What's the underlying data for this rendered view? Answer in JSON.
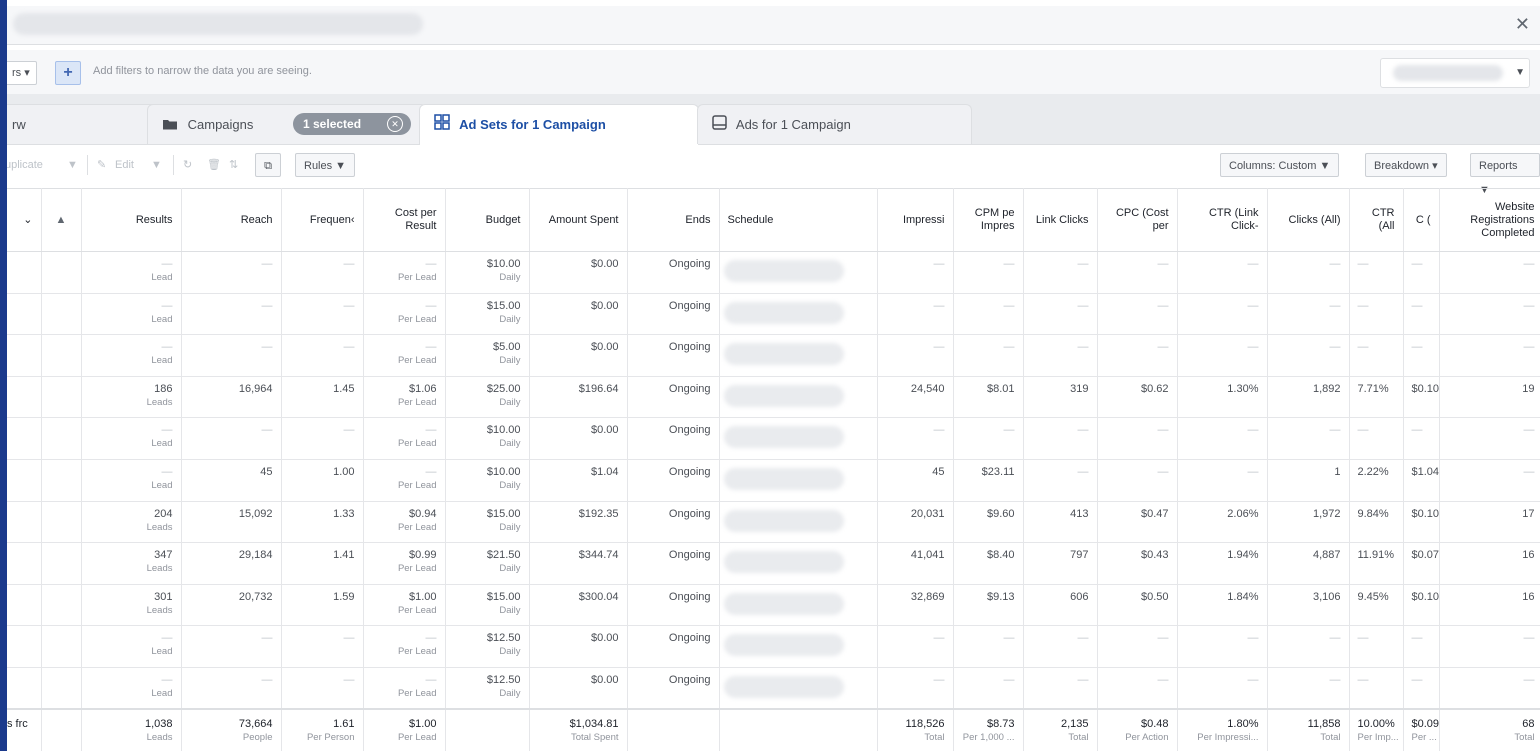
{
  "filter_bar": {
    "dropdown_label": "rs ▾",
    "plus_label": "+",
    "hint": "Add filters to narrow the data you are seeing."
  },
  "tabs": [
    {
      "label": "rw",
      "icon": "overview-icon"
    },
    {
      "label": "Campaigns",
      "icon": "folder-icon"
    },
    {
      "label": "Ad Sets for 1 Campaign",
      "icon": "grid-icon"
    },
    {
      "label": "Ads for 1 Campaign",
      "icon": "ad-icon"
    }
  ],
  "selection_pill": {
    "label": "1 selected"
  },
  "toolbar": {
    "duplicate": "uplicate",
    "edit": "Edit",
    "rules": "Rules ▼",
    "columns": "Columns: Custom ▼",
    "breakdown": "Breakdown ▾",
    "reports": "Reports ▼"
  },
  "columns": [
    "",
    "",
    "Results",
    "Reach",
    "Frequen‹",
    "Cost per Result",
    "Budget",
    "Amount Spent",
    "Ends",
    "Schedule",
    "Impressi",
    "CPM pe Impres",
    "Link Clicks",
    "CPC (Cost per",
    "CTR (Link Click-",
    "Clicks (All)",
    "CTR (All",
    "C (",
    "Website Registrations Completed"
  ],
  "rows": [
    {
      "results": "—",
      "results_sub": "Lead",
      "reach": "—",
      "freq": "—",
      "cpr": "—",
      "cpr_sub": "Per Lead",
      "budget": "$10.00",
      "budget_sub": "Daily",
      "spent": "$0.00",
      "ends": "Ongoing",
      "impr": "—",
      "cpm": "—",
      "link": "—",
      "cpc": "—",
      "ctr": "—",
      "clicks": "—",
      "ctrall": "—",
      "c": "—",
      "reg": "—"
    },
    {
      "results": "—",
      "results_sub": "Lead",
      "reach": "—",
      "freq": "—",
      "cpr": "—",
      "cpr_sub": "Per Lead",
      "budget": "$15.00",
      "budget_sub": "Daily",
      "spent": "$0.00",
      "ends": "Ongoing",
      "impr": "—",
      "cpm": "—",
      "link": "—",
      "cpc": "—",
      "ctr": "—",
      "clicks": "—",
      "ctrall": "—",
      "c": "—",
      "reg": "—"
    },
    {
      "results": "—",
      "results_sub": "Lead",
      "reach": "—",
      "freq": "—",
      "cpr": "—",
      "cpr_sub": "Per Lead",
      "budget": "$5.00",
      "budget_sub": "Daily",
      "spent": "$0.00",
      "ends": "Ongoing",
      "impr": "—",
      "cpm": "—",
      "link": "—",
      "cpc": "—",
      "ctr": "—",
      "clicks": "—",
      "ctrall": "—",
      "c": "—",
      "reg": "—"
    },
    {
      "results": "186",
      "results_sub": "Leads",
      "reach": "16,964",
      "freq": "1.45",
      "cpr": "$1.06",
      "cpr_sub": "Per Lead",
      "budget": "$25.00",
      "budget_sub": "Daily",
      "spent": "$196.64",
      "ends": "Ongoing",
      "impr": "24,540",
      "cpm": "$8.01",
      "link": "319",
      "cpc": "$0.62",
      "ctr": "1.30%",
      "clicks": "1,892",
      "ctrall": "7.71%",
      "c": "$0.10",
      "reg": "19"
    },
    {
      "results": "—",
      "results_sub": "Lead",
      "reach": "—",
      "freq": "—",
      "cpr": "—",
      "cpr_sub": "Per Lead",
      "budget": "$10.00",
      "budget_sub": "Daily",
      "spent": "$0.00",
      "ends": "Ongoing",
      "impr": "—",
      "cpm": "—",
      "link": "—",
      "cpc": "—",
      "ctr": "—",
      "clicks": "—",
      "ctrall": "—",
      "c": "—",
      "reg": "—"
    },
    {
      "results": "—",
      "results_sub": "Lead",
      "reach": "45",
      "freq": "1.00",
      "cpr": "—",
      "cpr_sub": "Per Lead",
      "budget": "$10.00",
      "budget_sub": "Daily",
      "spent": "$1.04",
      "ends": "Ongoing",
      "impr": "45",
      "cpm": "$23.11",
      "link": "—",
      "cpc": "—",
      "ctr": "—",
      "clicks": "1",
      "ctrall": "2.22%",
      "c": "$1.04",
      "reg": "—"
    },
    {
      "results": "204",
      "results_sub": "Leads",
      "reach": "15,092",
      "freq": "1.33",
      "cpr": "$0.94",
      "cpr_sub": "Per Lead",
      "budget": "$15.00",
      "budget_sub": "Daily",
      "spent": "$192.35",
      "ends": "Ongoing",
      "impr": "20,031",
      "cpm": "$9.60",
      "link": "413",
      "cpc": "$0.47",
      "ctr": "2.06%",
      "clicks": "1,972",
      "ctrall": "9.84%",
      "c": "$0.10",
      "reg": "17"
    },
    {
      "results": "347",
      "results_sub": "Leads",
      "reach": "29,184",
      "freq": "1.41",
      "cpr": "$0.99",
      "cpr_sub": "Per Lead",
      "budget": "$21.50",
      "budget_sub": "Daily",
      "spent": "$344.74",
      "ends": "Ongoing",
      "impr": "41,041",
      "cpm": "$8.40",
      "link": "797",
      "cpc": "$0.43",
      "ctr": "1.94%",
      "clicks": "4,887",
      "ctrall": "11.91%",
      "c": "$0.07",
      "reg": "16"
    },
    {
      "results": "301",
      "results_sub": "Leads",
      "reach": "20,732",
      "freq": "1.59",
      "cpr": "$1.00",
      "cpr_sub": "Per Lead",
      "budget": "$15.00",
      "budget_sub": "Daily",
      "spent": "$300.04",
      "ends": "Ongoing",
      "impr": "32,869",
      "cpm": "$9.13",
      "link": "606",
      "cpc": "$0.50",
      "ctr": "1.84%",
      "clicks": "3,106",
      "ctrall": "9.45%",
      "c": "$0.10",
      "reg": "16"
    },
    {
      "results": "—",
      "results_sub": "Lead",
      "reach": "—",
      "freq": "—",
      "cpr": "—",
      "cpr_sub": "Per Lead",
      "budget": "$12.50",
      "budget_sub": "Daily",
      "spent": "$0.00",
      "ends": "Ongoing",
      "impr": "—",
      "cpm": "—",
      "link": "—",
      "cpc": "—",
      "ctr": "—",
      "clicks": "—",
      "ctrall": "—",
      "c": "—",
      "reg": "—"
    },
    {
      "results": "—",
      "results_sub": "Lead",
      "reach": "—",
      "freq": "—",
      "cpr": "—",
      "cpr_sub": "Per Lead",
      "budget": "$12.50",
      "budget_sub": "Daily",
      "spent": "$0.00",
      "ends": "Ongoing",
      "impr": "—",
      "cpm": "—",
      "link": "—",
      "cpc": "—",
      "ctr": "—",
      "clicks": "—",
      "ctrall": "—",
      "c": "—",
      "reg": "—"
    }
  ],
  "totals": {
    "label": "s frc",
    "results": "1,038",
    "results_sub": "Leads",
    "reach": "73,664",
    "reach_sub": "People",
    "freq": "1.61",
    "freq_sub": "Per Person",
    "cpr": "$1.00",
    "cpr_sub": "Per Lead",
    "spent": "$1,034.81",
    "spent_sub": "Total Spent",
    "impr": "118,526",
    "impr_sub": "Total",
    "cpm": "$8.73",
    "cpm_sub": "Per 1,000 ...",
    "link": "2,135",
    "link_sub": "Total",
    "cpc": "$0.48",
    "cpc_sub": "Per Action",
    "ctr": "1.80%",
    "ctr_sub": "Per Impressi...",
    "clicks": "11,858",
    "clicks_sub": "Total",
    "ctrall": "10.00%",
    "ctrall_sub": "Per Imp...",
    "c": "$0.09",
    "c_sub": "Per ...",
    "reg": "68",
    "reg_sub": "Total"
  }
}
